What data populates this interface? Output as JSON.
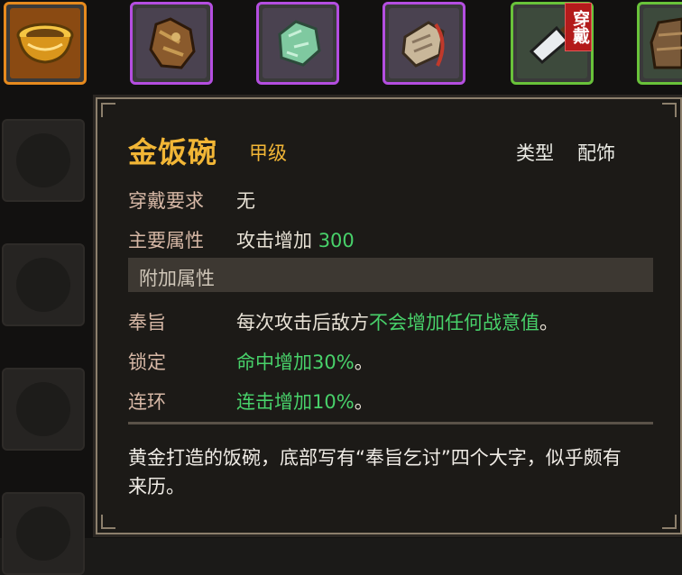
{
  "inventory": {
    "slots": [
      {
        "icon": "golden-bowl-icon",
        "rarity_color": "#e68a1e"
      },
      {
        "icon": "cloth-robe-icon",
        "rarity_color": "#b44ee0"
      },
      {
        "icon": "jade-stone-icon",
        "rarity_color": "#b44ee0"
      },
      {
        "icon": "pouch-icon",
        "rarity_color": "#b44ee0"
      },
      {
        "icon": "cleaver-icon",
        "rarity_color": "#69c23a",
        "tag": "穿戴"
      },
      {
        "icon": "armor-icon",
        "rarity_color": "#69c23a"
      }
    ]
  },
  "tooltip": {
    "name": "金饭碗",
    "grade": "甲级",
    "type_label": "类型",
    "type_value": "配饰",
    "requirement_label": "穿戴要求",
    "requirement_value": "无",
    "main_attr_label": "主要属性",
    "main_attr_text": "攻击增加",
    "main_attr_value": "300",
    "extra_section_title": "附加属性",
    "extra": [
      {
        "label": "奉旨",
        "prefix": "每次攻击后敌方",
        "highlight": "不会增加任何战意值",
        "suffix": "。"
      },
      {
        "label": "锁定",
        "prefix": "",
        "highlight": "命中增加30%",
        "suffix": "。"
      },
      {
        "label": "连环",
        "prefix": "",
        "highlight": "连击增加10%",
        "suffix": "。"
      }
    ],
    "description": "黄金打造的饭碗，底部写有“奉旨乞讨”四个大字，似乎颇有来历。"
  },
  "colors": {
    "name": "#f2b636",
    "highlight_green": "#48d16a",
    "label": "#d7b8a6"
  }
}
